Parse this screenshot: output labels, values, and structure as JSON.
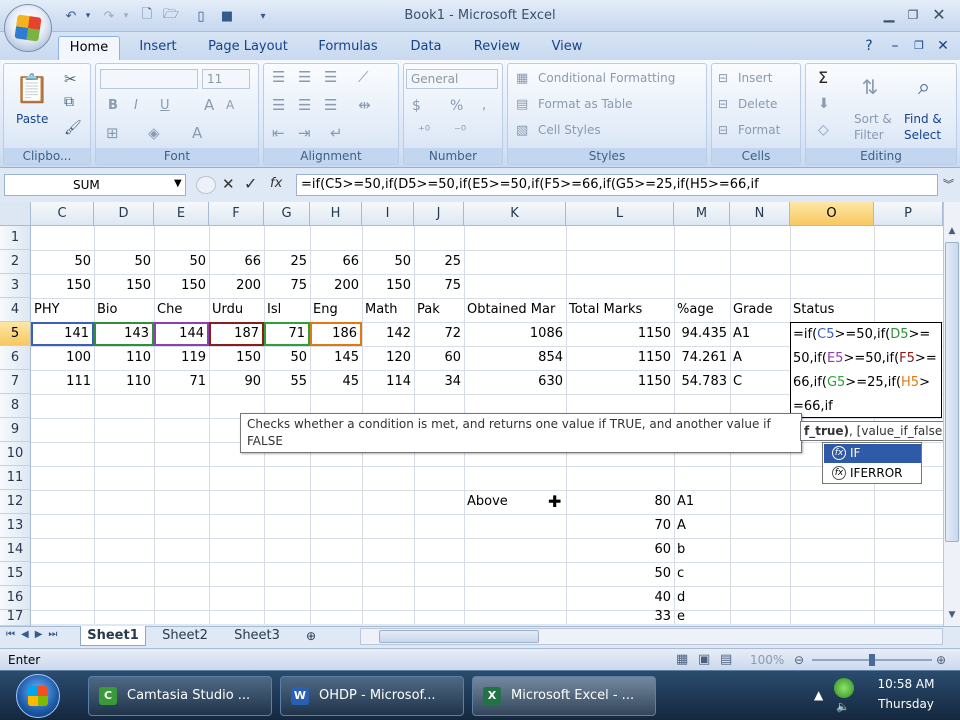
{
  "window": {
    "title": "Book1 - Microsoft Excel"
  },
  "tabs": [
    "Home",
    "Insert",
    "Page Layout",
    "Formulas",
    "Data",
    "Review",
    "View"
  ],
  "ribbon": {
    "clipboard": {
      "paste": "Paste",
      "label": "Clipbo..."
    },
    "font": {
      "size": "11",
      "bold": "B",
      "italic": "I",
      "underline": "U",
      "label": "Font"
    },
    "alignment": {
      "label": "Alignment"
    },
    "number": {
      "format": "General",
      "currency": "$",
      "percent": "%",
      "label": "Number"
    },
    "styles": {
      "conditional": "Conditional Formatting",
      "format_table": "Format as Table",
      "cell_styles": "Cell Styles",
      "label": "Styles"
    },
    "cells": {
      "insert": "Insert",
      "delete": "Delete",
      "format": "Format",
      "label": "Cells"
    },
    "editing": {
      "sum": "Σ",
      "sort": "Sort &",
      "filter": "Filter",
      "find": "Find &",
      "select": "Select",
      "label": "Editing"
    }
  },
  "formula_bar": {
    "name_box": "SUM",
    "fx": "fx",
    "formula": "=if(C5>=50,if(D5>=50,if(E5>=50,if(F5>=66,if(G5>=25,if(H5>=66,if"
  },
  "columns": [
    "C",
    "D",
    "E",
    "F",
    "G",
    "H",
    "I",
    "J",
    "K",
    "L",
    "M",
    "N",
    "O",
    "P"
  ],
  "rows": [
    "1",
    "2",
    "3",
    "4",
    "5",
    "6",
    "7",
    "8",
    "9",
    "10",
    "11",
    "12",
    "13",
    "14",
    "15",
    "16",
    "17"
  ],
  "cells": {
    "r2": [
      "50",
      "50",
      "50",
      "66",
      "25",
      "66",
      "50",
      "25"
    ],
    "r3": [
      "150",
      "150",
      "150",
      "200",
      "75",
      "200",
      "150",
      "75"
    ],
    "r4": {
      "c": "PHY",
      "d": "Bio",
      "e": "Che",
      "f": "Urdu",
      "g": "Isl",
      "h": "Eng",
      "i": "Math",
      "j": "Pak",
      "k": "Obtained Mar",
      "l": "Total Marks",
      "m": "%age",
      "n": "Grade",
      "o": "Status"
    },
    "r5": {
      "nums": [
        "141",
        "143",
        "144",
        "187",
        "71",
        "186",
        "142",
        "72"
      ],
      "k": "1086",
      "l": "1150",
      "m": "94.435",
      "n": "A1"
    },
    "r6": {
      "nums": [
        "100",
        "110",
        "119",
        "150",
        "50",
        "145",
        "120",
        "60"
      ],
      "k": "854",
      "l": "1150",
      "m": "74.261",
      "n": "A"
    },
    "r7": {
      "nums": [
        "111",
        "110",
        "71",
        "90",
        "55",
        "45",
        "114",
        "34"
      ],
      "k": "630",
      "l": "1150",
      "m": "54.783",
      "n": "C"
    },
    "grade_table": {
      "above": "Above",
      "marks": [
        "80",
        "70",
        "60",
        "50",
        "40",
        "33"
      ],
      "grades": [
        "A1",
        "A",
        "b",
        "c",
        "d",
        "e"
      ]
    }
  },
  "edit_cell": {
    "line1_a": "=if(",
    "line1_b": "C5",
    "line1_c": ">=50,if(",
    "line1_d": "D5",
    "line1_e": ">=",
    "line2_a": "50,if(",
    "line2_b": "E5",
    "line2_c": ">=50,if(",
    "line2_d": "F5",
    "line2_e": ">=",
    "line3_a": "66,if(",
    "line3_b": "G5",
    "line3_c": ">=25,if(",
    "line3_d": "H5",
    "line3_e": ">",
    "line4": "=66,if"
  },
  "tooltip": {
    "text": "Checks whether a condition is met, and returns one value if TRUE, and another value if FALSE"
  },
  "arg_tip": {
    "current": "f_true)",
    "rest": ", [value_if_false])"
  },
  "autocomplete": [
    "IF",
    "IFERROR"
  ],
  "sheets": [
    "Sheet1",
    "Sheet2",
    "Sheet3"
  ],
  "status": {
    "mode": "Enter",
    "zoom": "100%"
  },
  "taskbar": {
    "tasks": [
      "Camtasia Studio ...",
      "OHDP - Microsof...",
      "Microsoft Excel - ..."
    ],
    "time": "10:58 AM",
    "day": "Thursday"
  },
  "colors": {
    "c5_ref": "#3b5fc0",
    "d5_ref": "#2f8f3a",
    "e5_ref": "#8b3fb0",
    "f5_ref": "#8a1c1c",
    "g5_ref": "#2f9f3a",
    "h5_ref": "#e07a10"
  }
}
